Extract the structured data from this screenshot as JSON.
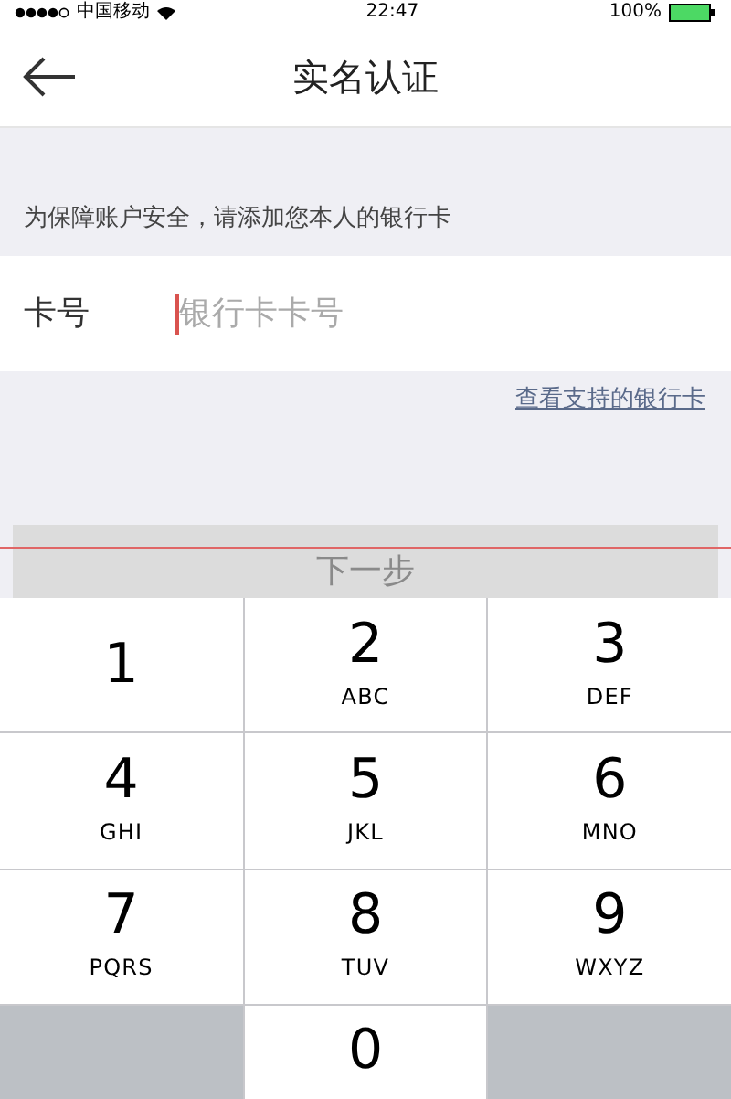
{
  "status_bar": {
    "carrier": "中国移动",
    "time": "22:47",
    "battery": "100%"
  },
  "nav": {
    "title": "实名认证"
  },
  "hint": "为保障账户安全，请添加您本人的银行卡",
  "card_field": {
    "label": "卡号",
    "placeholder": "银行卡卡号"
  },
  "supported_link": "查看支持的银行卡",
  "next_button": {
    "label": "下一步",
    "disabled": true
  },
  "keypad": [
    {
      "kind": "digit",
      "digit": "1"
    },
    {
      "kind": "digit",
      "digit": "2",
      "letters": "ABC"
    },
    {
      "kind": "digit",
      "digit": "3",
      "letters": "DEF"
    },
    {
      "kind": "digit",
      "digit": "4",
      "letters": "GHI"
    },
    {
      "kind": "digit",
      "digit": "5",
      "letters": "JKL"
    },
    {
      "kind": "digit",
      "digit": "6",
      "letters": "MNO"
    },
    {
      "kind": "digit",
      "digit": "7",
      "letters": "PQRS"
    },
    {
      "kind": "digit",
      "digit": "8",
      "letters": "TUV"
    },
    {
      "kind": "digit",
      "digit": "9",
      "letters": "WXYZ"
    },
    {
      "kind": "blank"
    },
    {
      "kind": "digit",
      "digit": "0"
    },
    {
      "kind": "blank"
    }
  ]
}
